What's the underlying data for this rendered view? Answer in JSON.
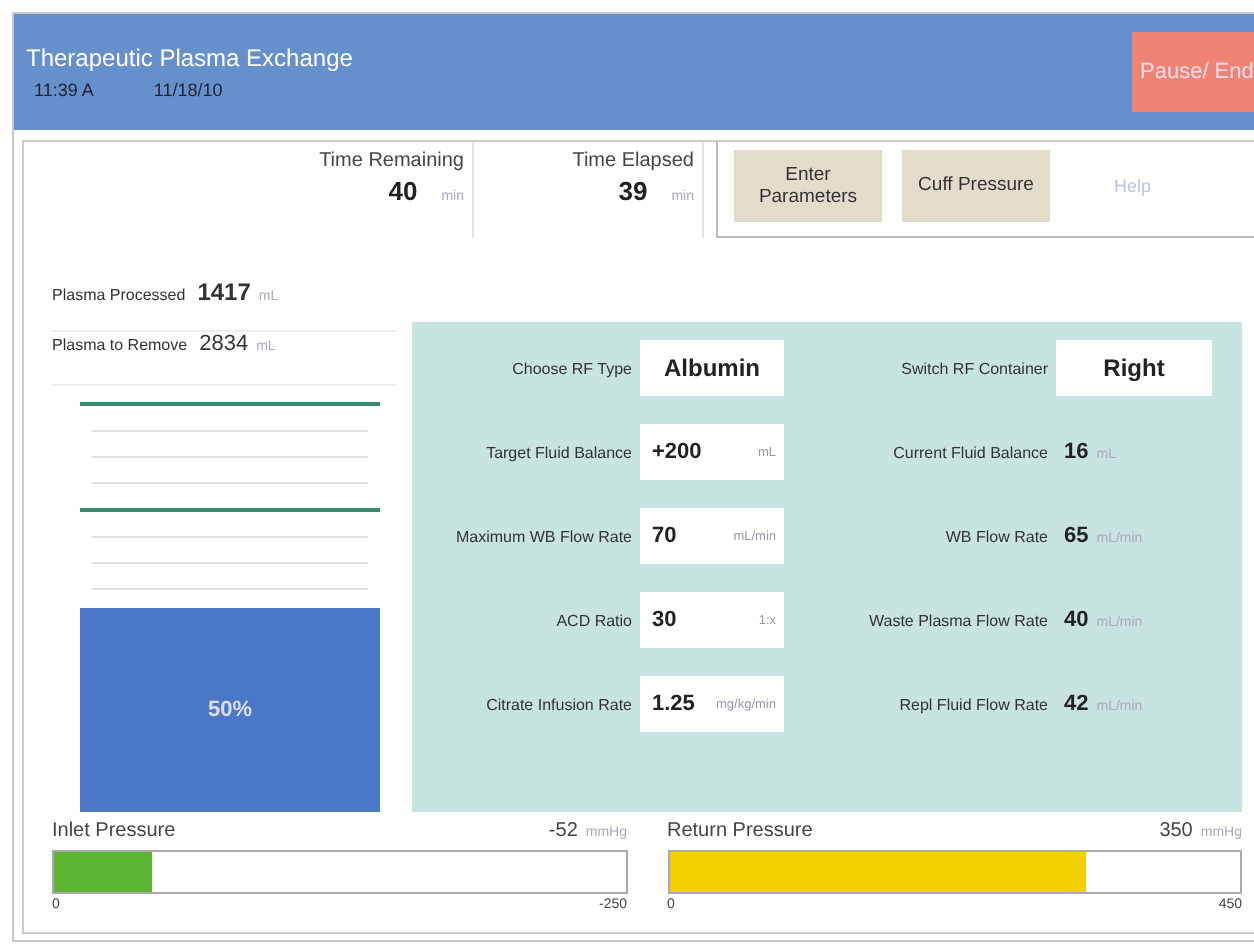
{
  "header": {
    "title": "Therapeutic Plasma Exchange",
    "time": "11:39 A",
    "date": "11/18/10",
    "pause_button": "Pause/ End"
  },
  "timers": [
    {
      "label": "Time Remaining",
      "value": "40",
      "unit": "min"
    },
    {
      "label": "Time Elapsed",
      "value": "39",
      "unit": "min"
    }
  ],
  "tabs": [
    {
      "label": "Enter Parameters"
    },
    {
      "label": "Cuff Pressure"
    }
  ],
  "help": "Help",
  "plasma": [
    {
      "label": "Plasma Processed",
      "value": "1417",
      "unit": "mL",
      "bold": true
    },
    {
      "label": "Plasma to Remove",
      "value": "2834",
      "unit": "mL",
      "bold": false
    }
  ],
  "reservoir": {
    "level": 0.5,
    "reading": "50%"
  },
  "parameters": [
    {
      "left": {
        "kind": "select",
        "label": "Choose RF Type",
        "value": "Albumin"
      },
      "right": {
        "kind": "select",
        "label": "Switch RF Container",
        "value": "Right"
      }
    },
    {
      "left": {
        "kind": "input",
        "label": "Target Fluid Balance",
        "value": "+200",
        "unit": "mL"
      },
      "right": {
        "kind": "reading",
        "label": "Current Fluid Balance",
        "value": "16",
        "unit": "mL"
      }
    },
    {
      "left": {
        "kind": "input",
        "label": "Maximum WB Flow Rate",
        "value": "70",
        "unit": "mL/min"
      },
      "right": {
        "kind": "reading",
        "label": "WB Flow Rate",
        "value": "65",
        "unit": "mL/min"
      }
    },
    {
      "left": {
        "kind": "input",
        "label": "ACD Ratio",
        "value": "30",
        "unit": "1:x"
      },
      "right": {
        "kind": "reading",
        "label": "Waste Plasma Flow Rate",
        "value": "40",
        "unit": "mL/min"
      }
    },
    {
      "left": {
        "kind": "input",
        "label": "Citrate Infusion Rate",
        "value": "1.25",
        "unit": "mg/kg/min"
      },
      "right": {
        "kind": "reading",
        "label": "Repl Fluid Flow Rate",
        "value": "42",
        "unit": "mL/min"
      }
    }
  ],
  "pressures": [
    {
      "label": "Inlet Pressure",
      "reading": "-52",
      "unit": "mmHg",
      "level": 0.17,
      "color": "#5cb533",
      "min": "0",
      "max": "-250"
    },
    {
      "label": "Return Pressure",
      "reading": "350",
      "unit": "mmHg",
      "level": 0.73,
      "color": "#f5d000",
      "min": "0",
      "max": "450"
    }
  ]
}
